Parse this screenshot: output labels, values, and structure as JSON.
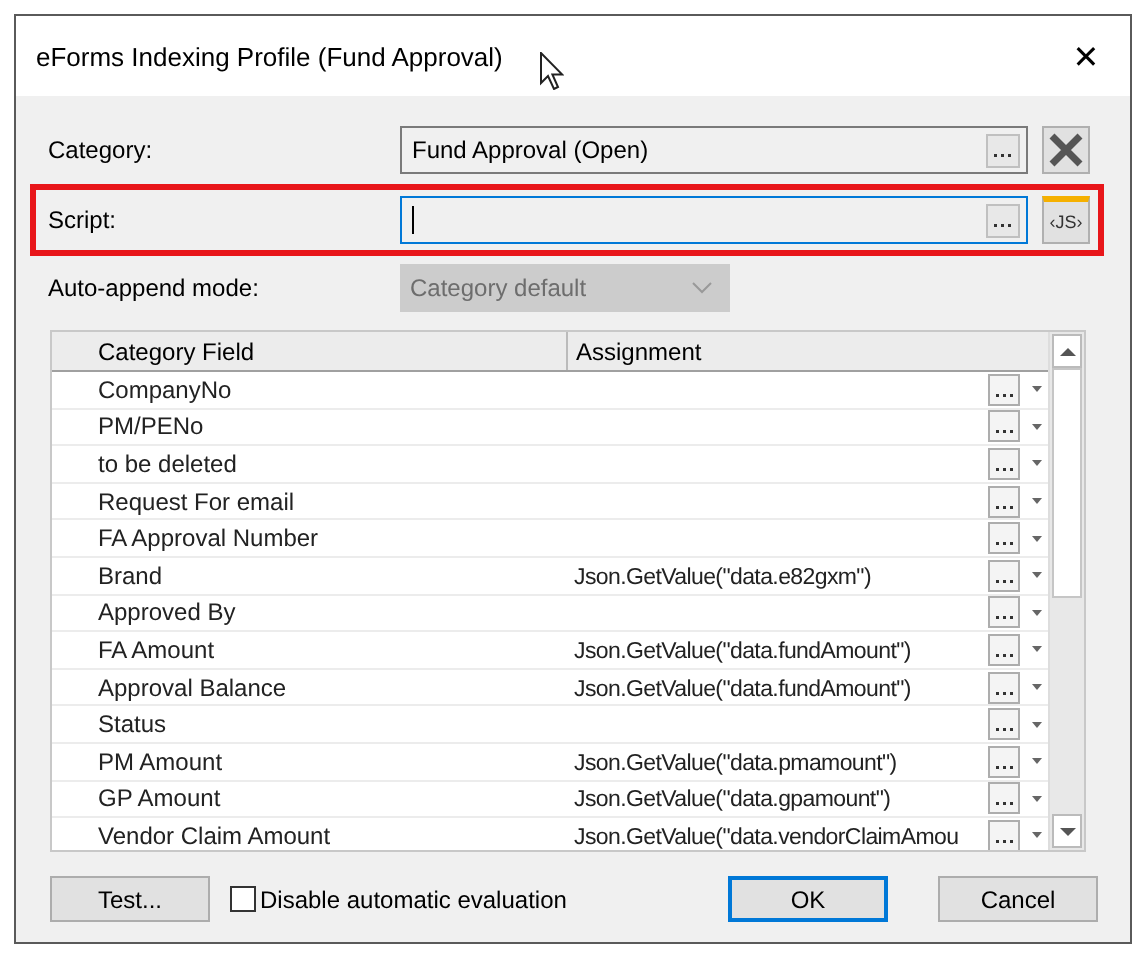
{
  "window": {
    "title": "eForms Indexing Profile (Fund Approval)",
    "close": "✕"
  },
  "category": {
    "label": "Category:",
    "value": "Fund Approval (Open)"
  },
  "script": {
    "label": "Script:",
    "focused": true,
    "highlighted": true,
    "js_button": "‹JS›"
  },
  "auto_append": {
    "label": "Auto-append mode:",
    "value": "Category default",
    "disabled": true
  },
  "table": {
    "columns": [
      "Category Field",
      "Assignment"
    ],
    "rows": [
      {
        "field": "CompanyNo"
      },
      {
        "field": "PM/PENo"
      },
      {
        "field": "to be deleted"
      },
      {
        "field": "Request For email"
      },
      {
        "field": "FA Approval Number"
      },
      {
        "field": "Brand",
        "assignment": "Json.GetValue(\"data.e82gxm\")"
      },
      {
        "field": "Approved By"
      },
      {
        "field": "FA Amount",
        "assignment": "Json.GetValue(\"data.fundAmount\")"
      },
      {
        "field": "Approval Balance",
        "assignment": "Json.GetValue(\"data.fundAmount\")"
      },
      {
        "field": "Status"
      },
      {
        "field": "PM Amount",
        "assignment": "Json.GetValue(\"data.pmamount\")"
      },
      {
        "field": "GP Amount",
        "assignment": "Json.GetValue(\"data.gpamount\")"
      },
      {
        "field": "Vendor Claim Amount",
        "assignment": "Json.GetValue(\"data.vendorClaimAmou"
      }
    ]
  },
  "footer": {
    "test_button": "Test...",
    "checkbox": {
      "label": "Disable automatic evaluation",
      "checked": false
    },
    "buttons": [
      {
        "label": "OK",
        "default": true
      },
      {
        "label": "Cancel",
        "default": false
      }
    ]
  }
}
